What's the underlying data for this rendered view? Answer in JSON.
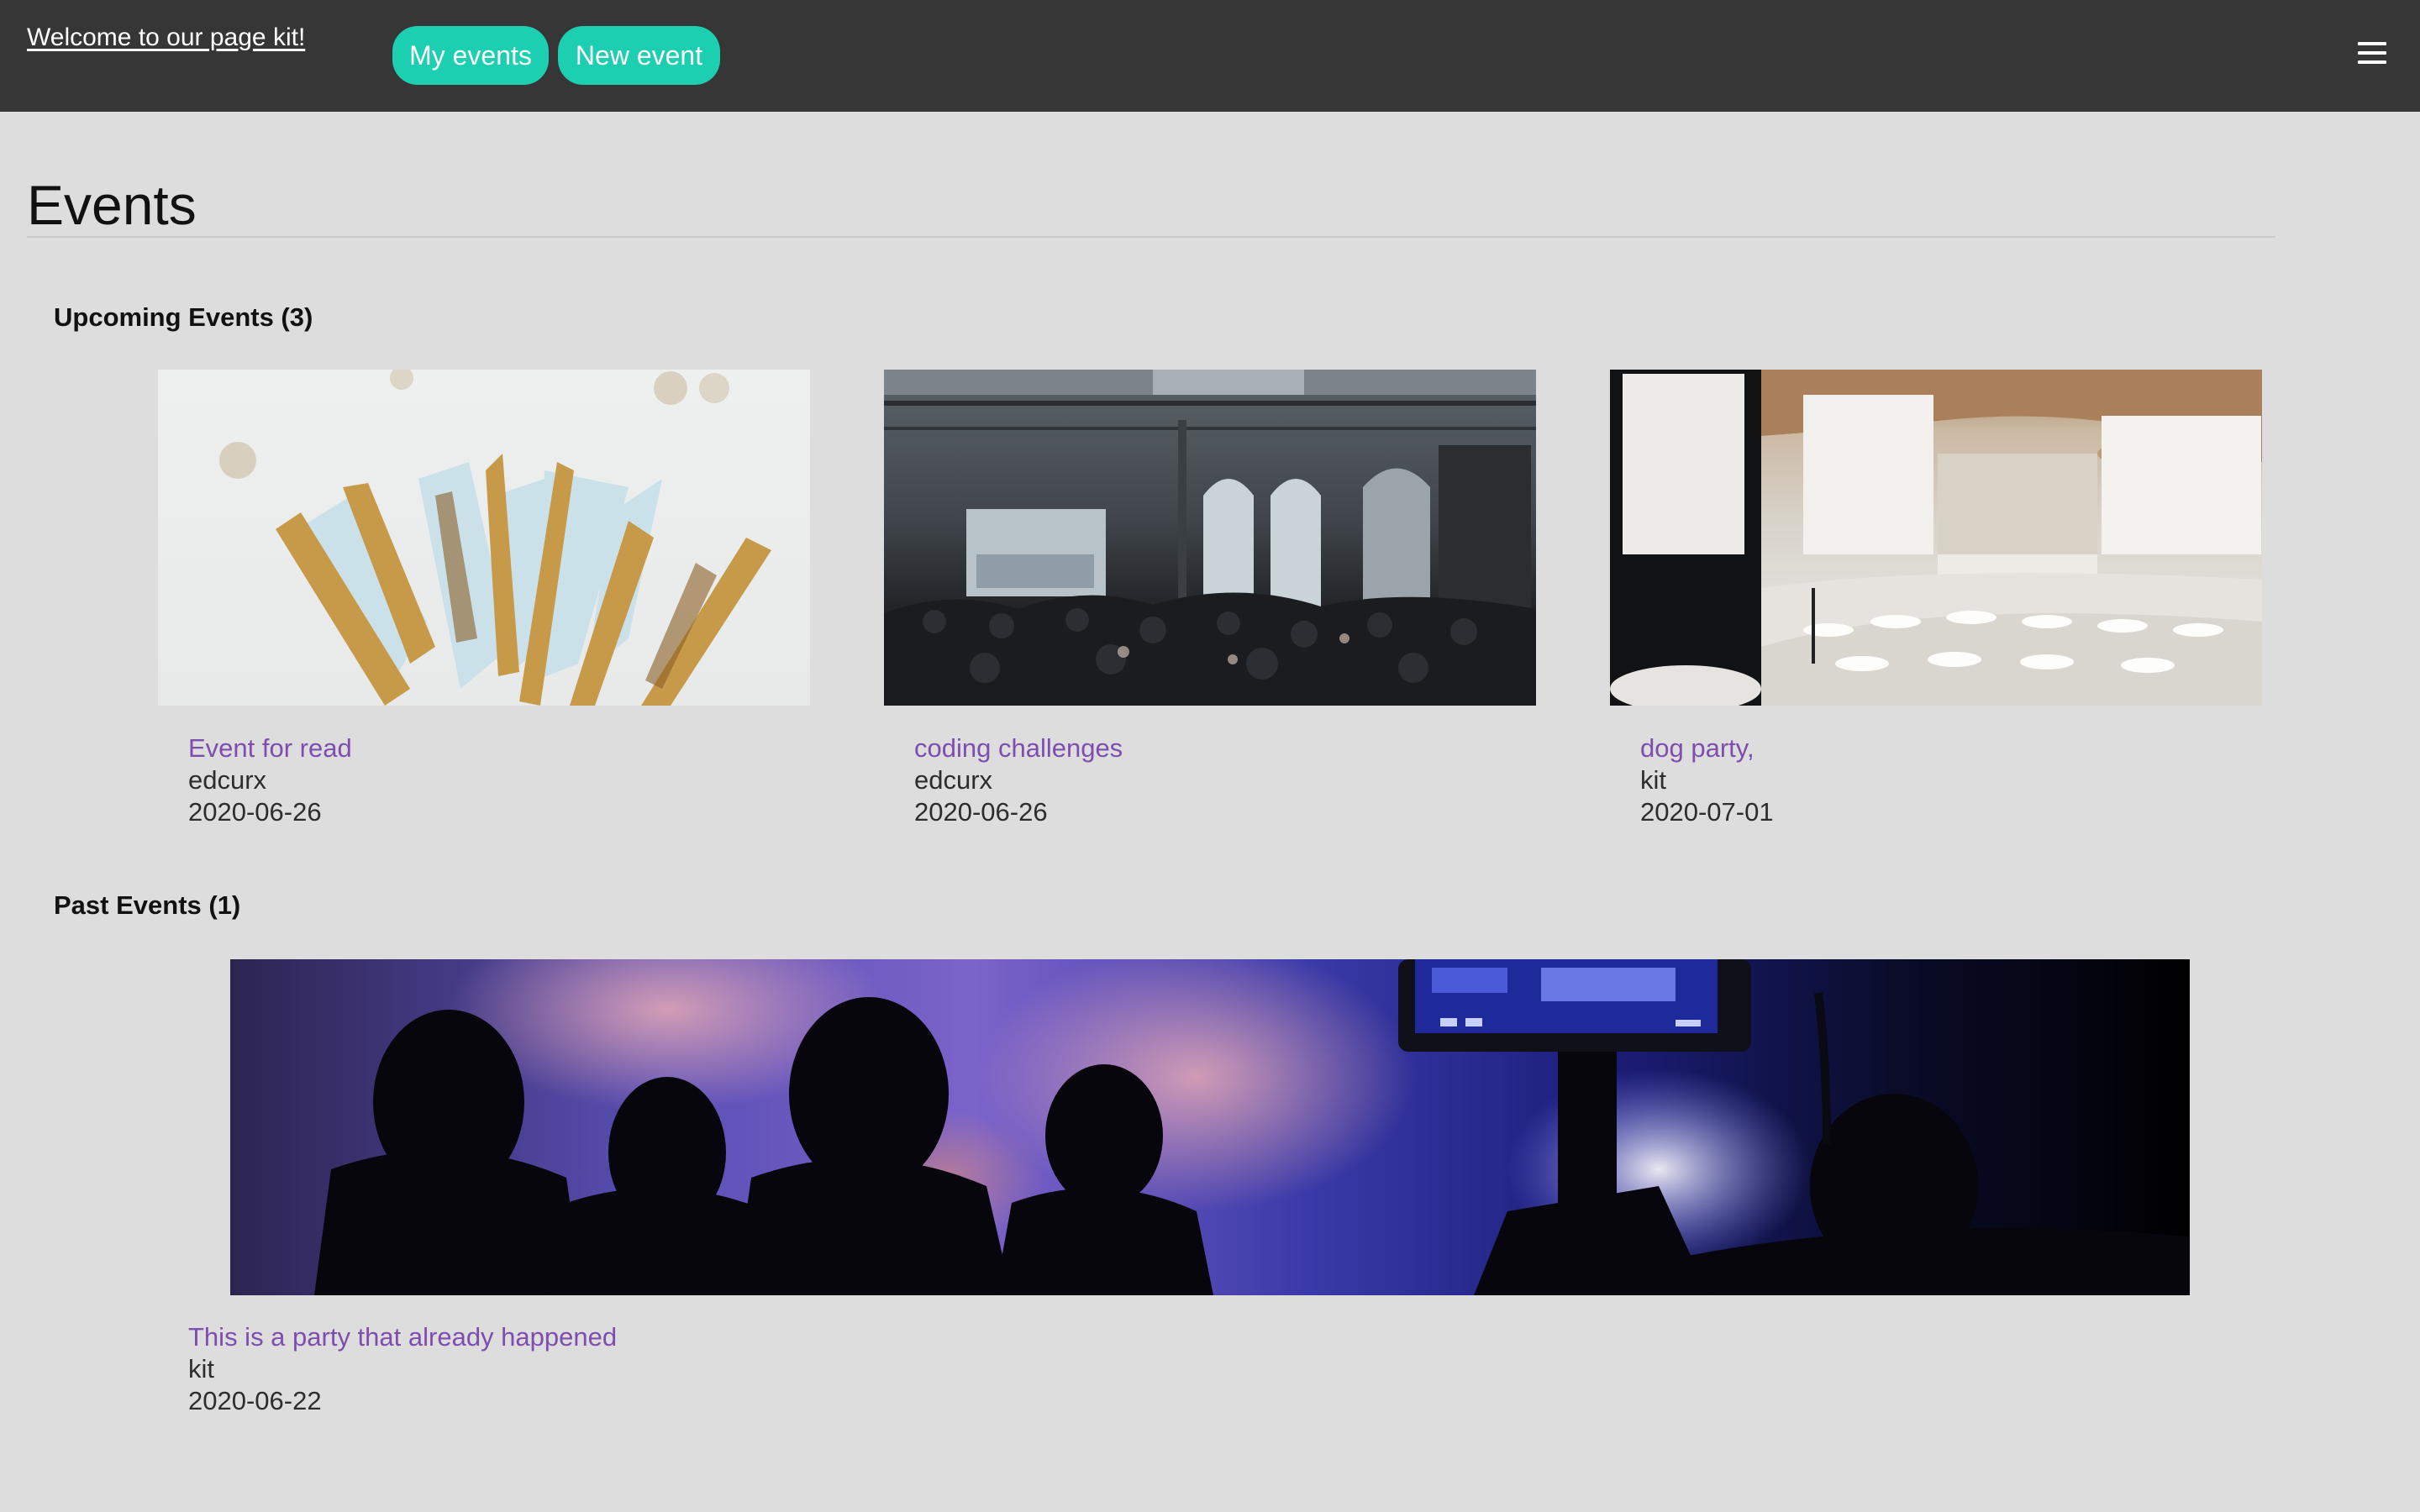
{
  "header": {
    "welcome_link": "Welcome to our page kit!",
    "my_events_label": "My events",
    "new_event_label": "New event",
    "menu_icon": "hamburger-menu-icon"
  },
  "colors": {
    "topbar": "#363636",
    "accent": "#1ccfb0",
    "page_bg": "#dddddd",
    "event_link": "#7e4db0"
  },
  "page": {
    "title": "Events"
  },
  "upcoming": {
    "heading": "Upcoming Events (3)",
    "events": [
      {
        "title": "Event for read",
        "owner": "edcurx",
        "date": "2020-06-26",
        "image": "gold-and-white-streamers-photo"
      },
      {
        "title": "coding challenges",
        "owner": "edcurx",
        "date": "2020-06-26",
        "image": "crowded-hall-with-projector-photo"
      },
      {
        "title": "dog party,",
        "owner": "kit",
        "date": "2020-07-01",
        "image": "conference-hall-with-screens-photo"
      }
    ]
  },
  "past": {
    "heading": "Past Events (1)",
    "events": [
      {
        "title": "This is a party that already happened",
        "owner": "kit",
        "date": "2020-06-22",
        "image": "concert-crowd-with-camera-photo"
      }
    ]
  }
}
